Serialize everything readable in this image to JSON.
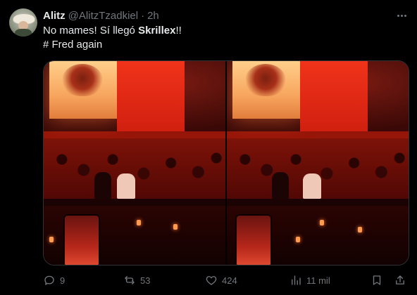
{
  "tweet": {
    "name": "Alitz",
    "handle": "@AlitzTzadkiel",
    "separator": "·",
    "time": "2h",
    "text_line1_prefix": "No mames! Sí llegó ",
    "text_line1_bold": "Skrillex",
    "text_line1_suffix": "!!",
    "text_line2": "# Fred again"
  },
  "actions": {
    "replies": "9",
    "reposts": "53",
    "likes": "424",
    "views": "11 mil"
  },
  "icons": {
    "more": "more-icon",
    "reply": "reply-icon",
    "repost": "repost-icon",
    "like": "heart-icon",
    "views": "views-icon",
    "bookmark": "bookmark-icon",
    "share": "share-icon"
  },
  "colors": {
    "background": "#000000",
    "text": "#e7e9ea",
    "secondary_text": "#71767b",
    "border": "#2f3336"
  }
}
